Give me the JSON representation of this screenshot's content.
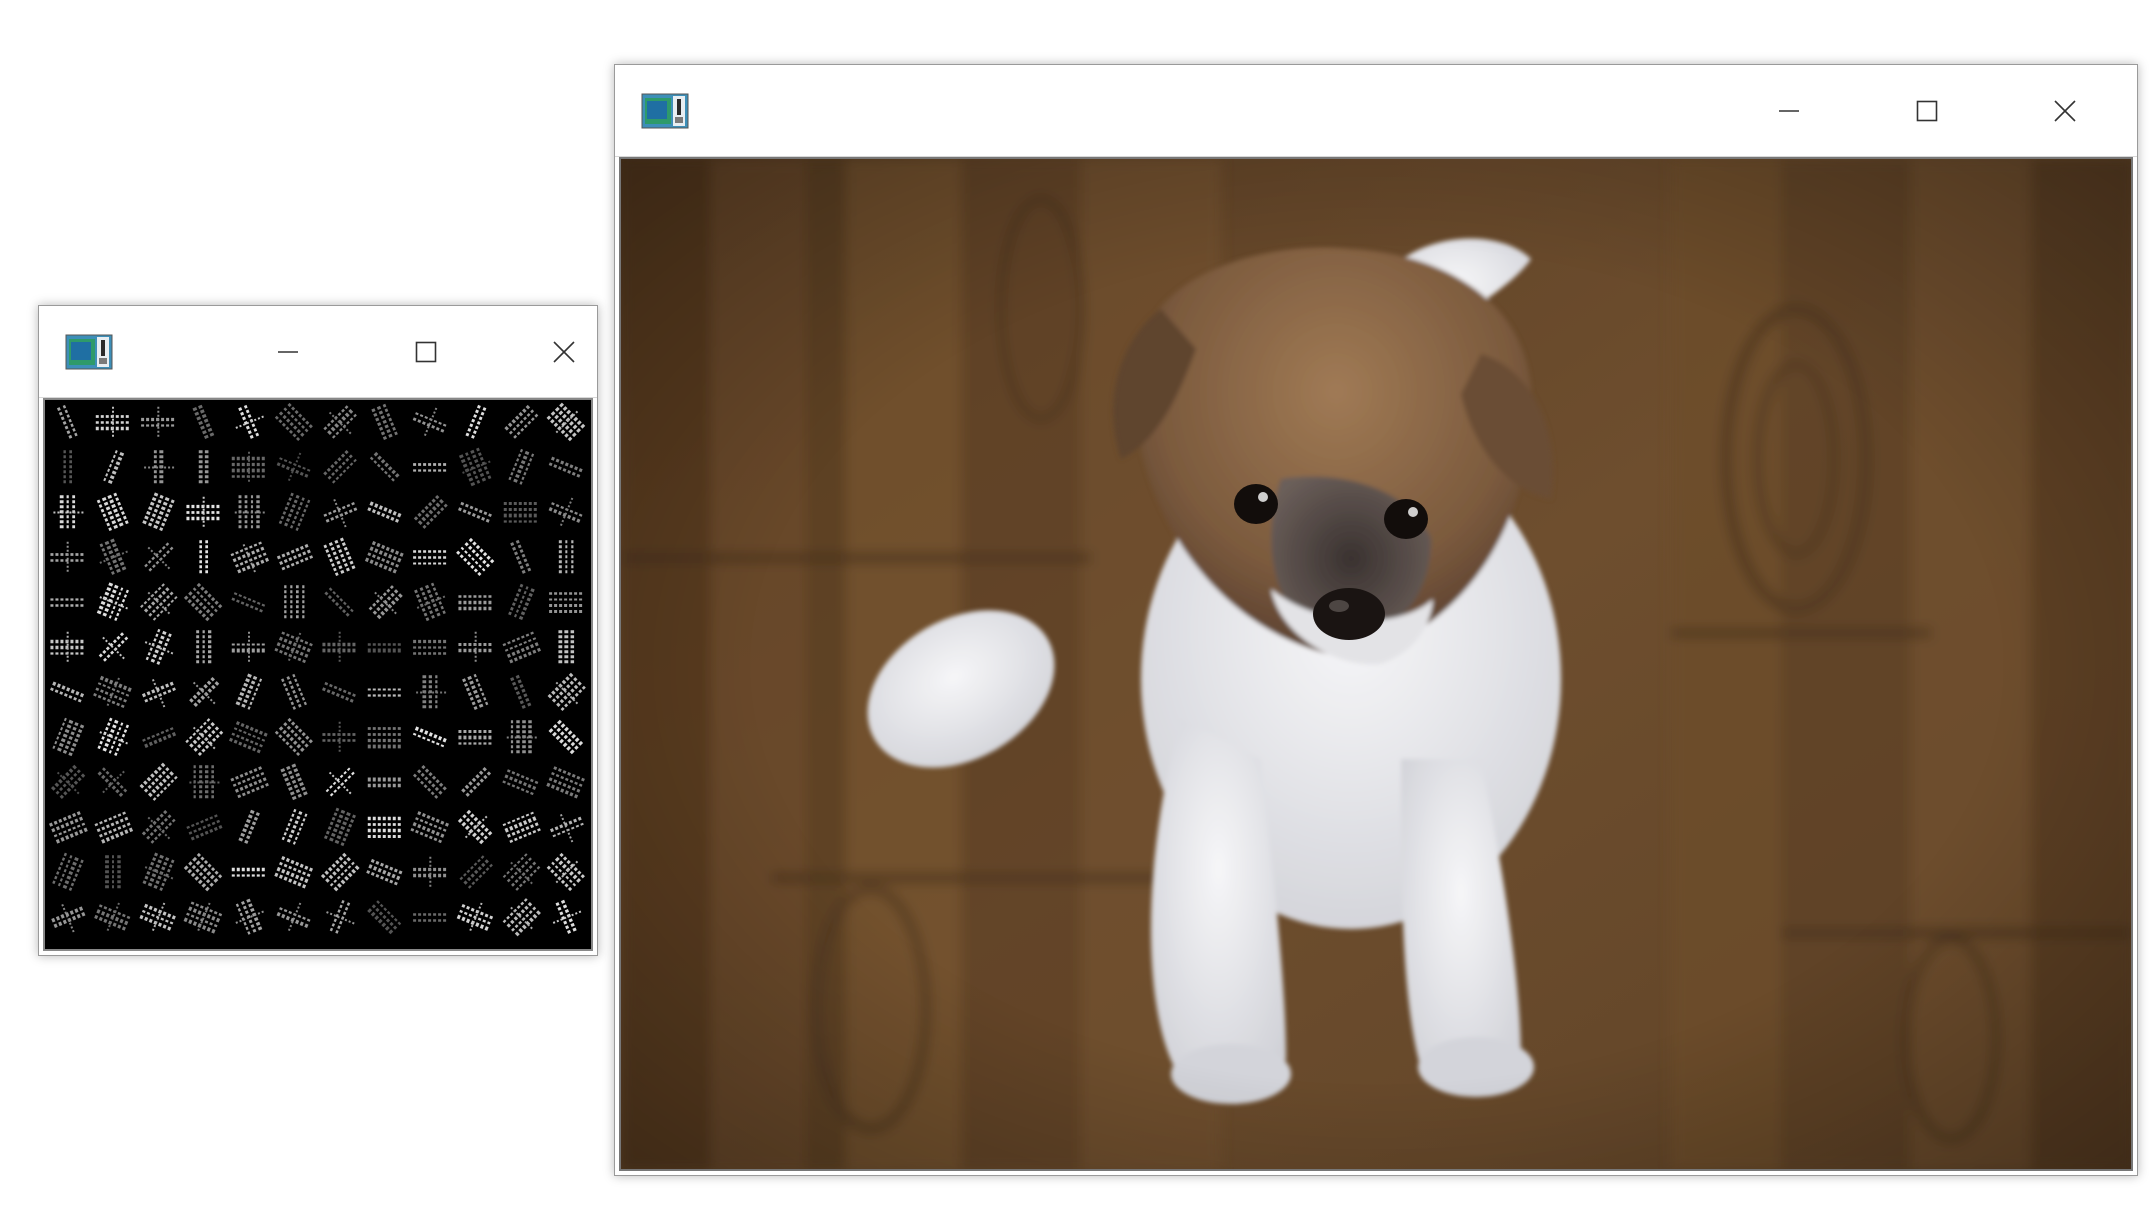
{
  "windows": [
    {
      "title": "",
      "icon": "opencv-window-icon",
      "controls": [
        "minimize-icon",
        "maximize-icon",
        "close-icon"
      ],
      "content": "gabor-filter-bank-grid",
      "grid": {
        "rows": 12,
        "cols": 12
      }
    },
    {
      "title": "",
      "icon": "opencv-window-icon",
      "controls": [
        "minimize-icon",
        "maximize-icon",
        "close-icon"
      ],
      "content": "puppy-photo"
    }
  ],
  "colors": {
    "desktop": "#ffffff",
    "window_border": "#9a9a9a",
    "filter_background": "#000000",
    "wood_floor": "#6b4b2a",
    "puppy_white": "#e9e9ec",
    "puppy_brown": "#7a5a3c"
  }
}
